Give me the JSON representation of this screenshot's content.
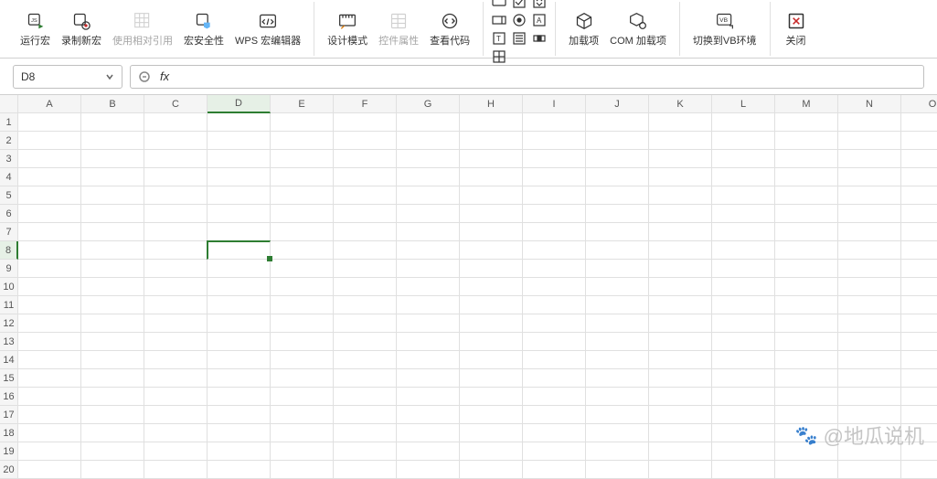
{
  "ribbon": {
    "group1": {
      "run_macro": "运行宏",
      "record_new_macro": "录制新宏",
      "relative_reference": "使用相对引用",
      "macro_security": "宏安全性",
      "wps_macro_editor": "WPS 宏编辑器"
    },
    "group2": {
      "design_mode": "设计模式",
      "control_properties": "控件属性",
      "view_code": "查看代码"
    },
    "group3": {
      "addins": "加载项",
      "com_addins": "COM 加载项"
    },
    "group4": {
      "switch_to_vb": "切换到VB环境"
    },
    "group5": {
      "close": "关闭"
    }
  },
  "formula_bar": {
    "cell_reference": "D8",
    "fx_label": "fx",
    "formula_value": ""
  },
  "sheet": {
    "columns": [
      "A",
      "B",
      "C",
      "D",
      "E",
      "F",
      "G",
      "H",
      "I",
      "J",
      "K",
      "L",
      "M",
      "N",
      "O"
    ],
    "rows": [
      1,
      2,
      3,
      4,
      5,
      6,
      7,
      8,
      9,
      10,
      11,
      12,
      13,
      14,
      15,
      16,
      17,
      18,
      19,
      20
    ],
    "active_cell": "D8",
    "active_col_index": 3,
    "active_row_index": 7
  },
  "watermark": {
    "text": "@地瓜说机"
  }
}
